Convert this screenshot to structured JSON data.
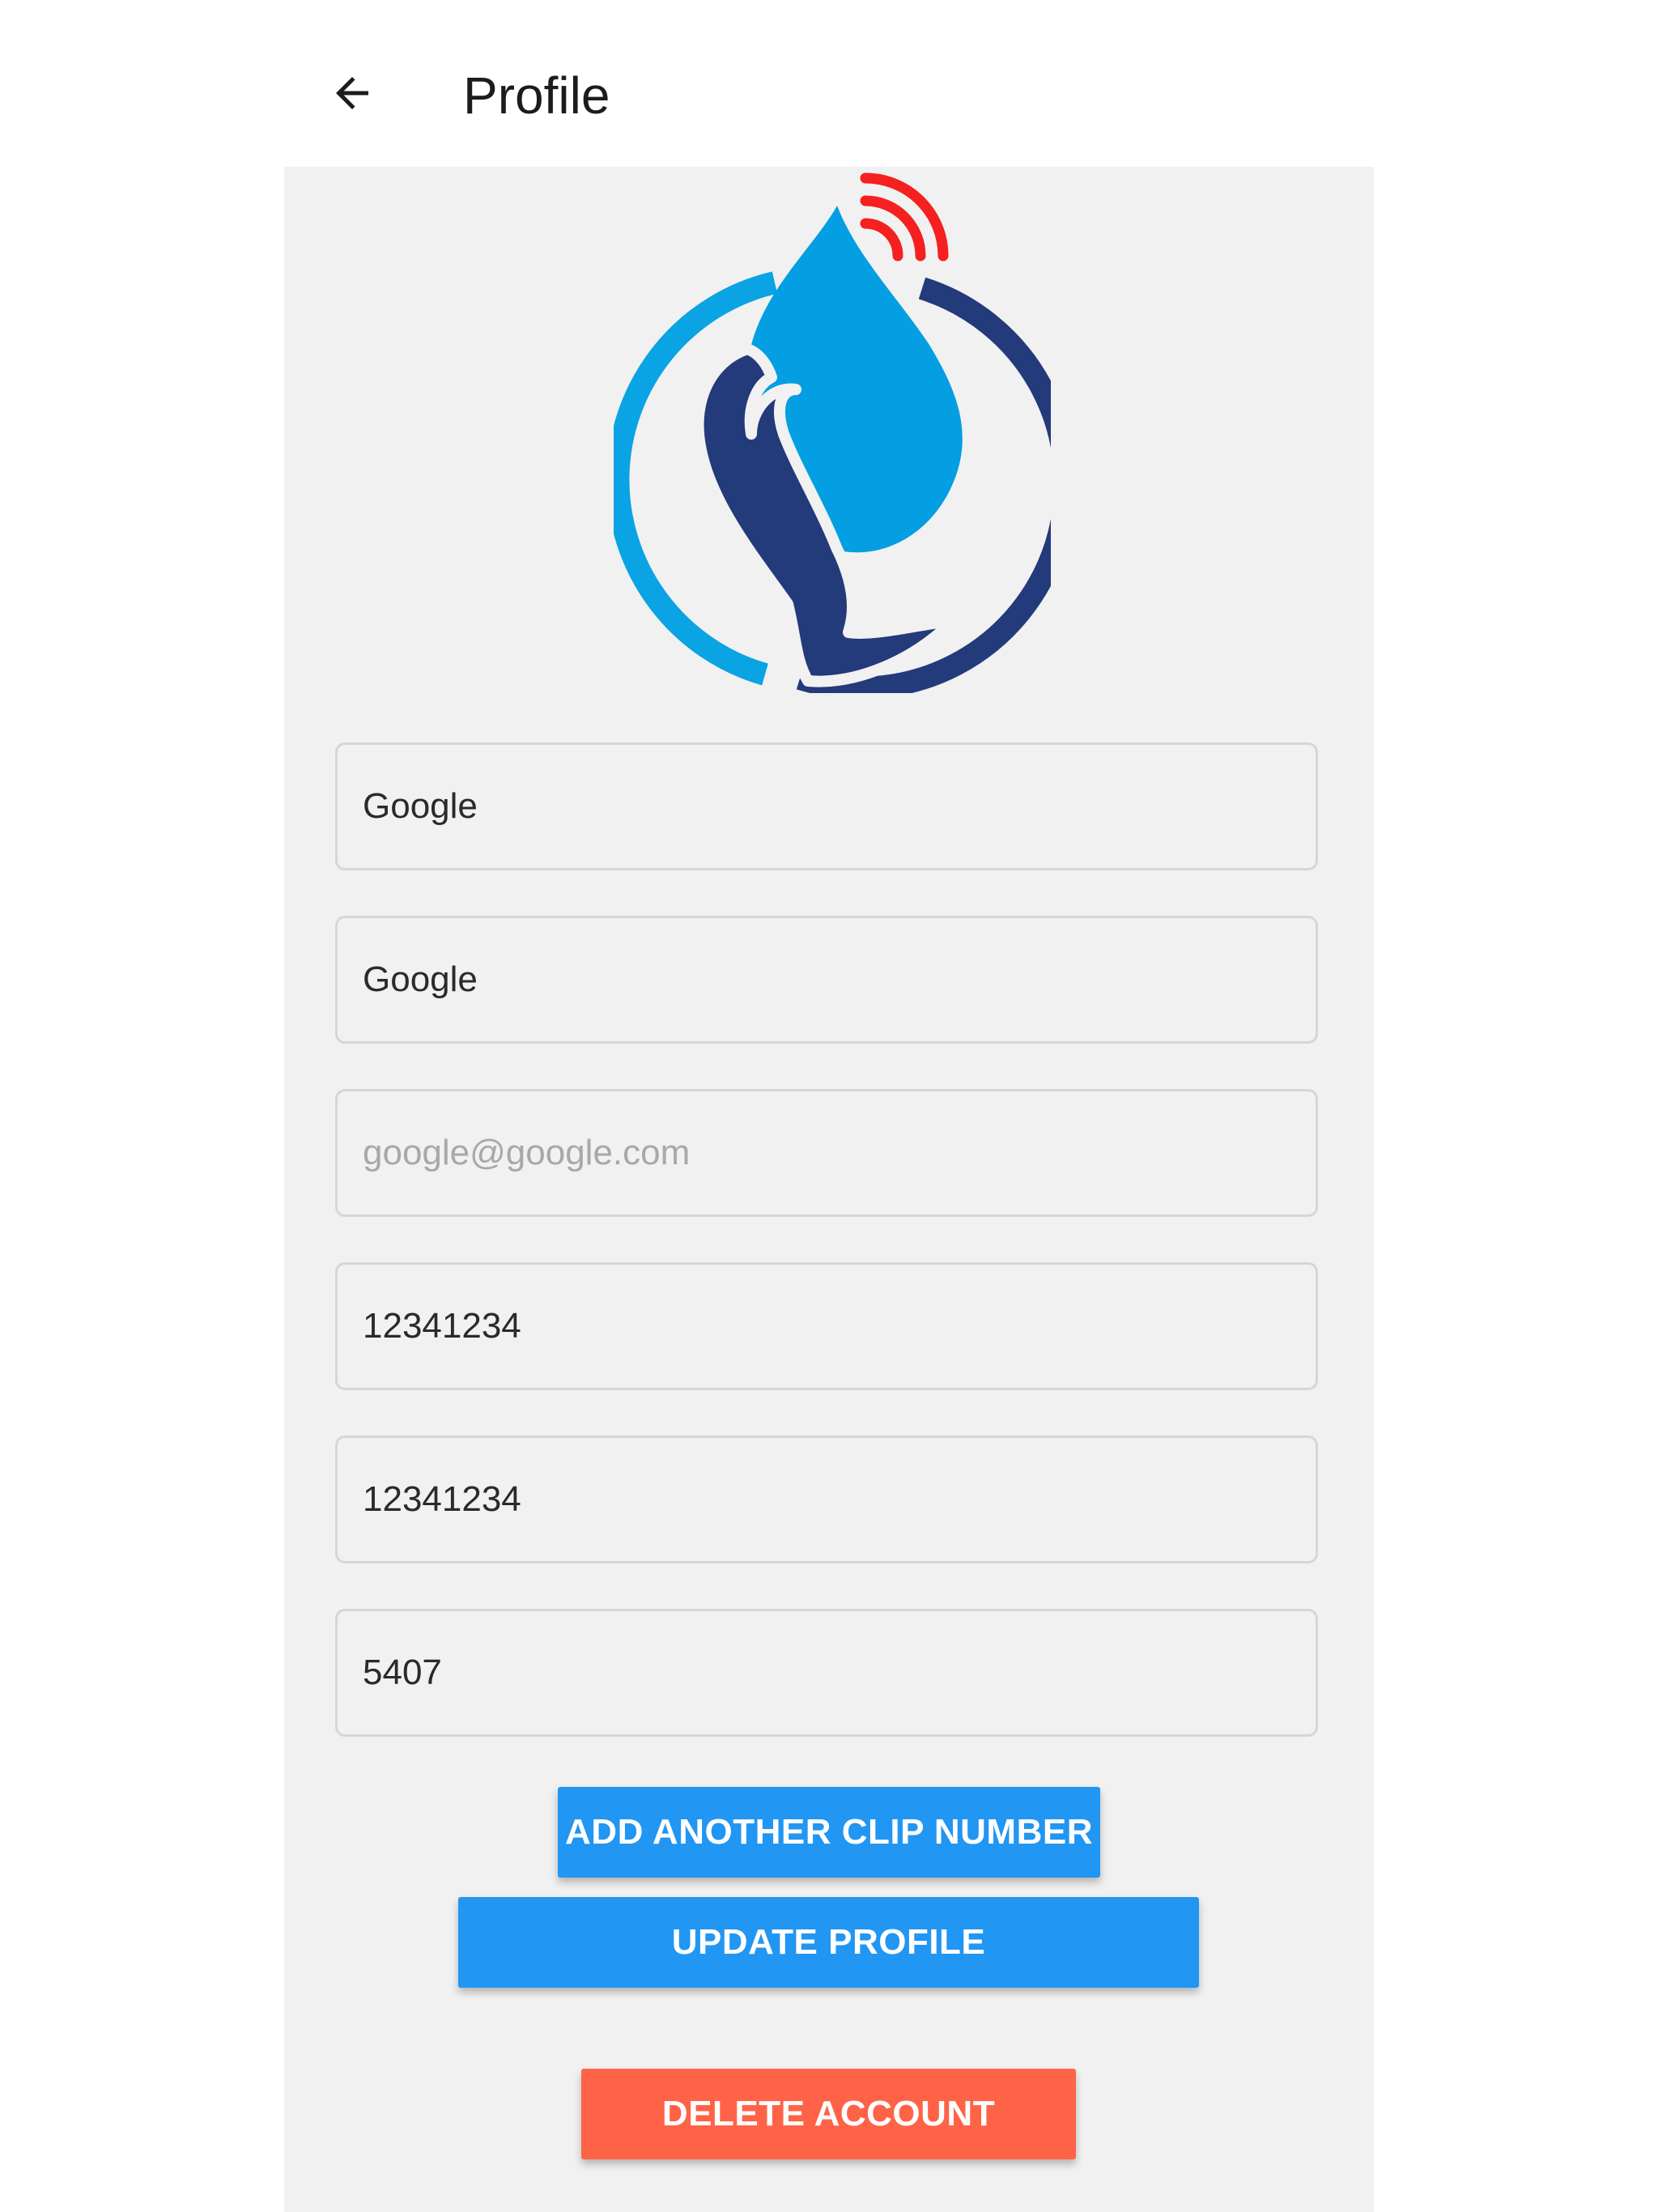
{
  "header": {
    "title": "Profile",
    "back_icon": "arrow-left-icon"
  },
  "logo": {
    "icon": "water-drop-hand-logo",
    "colors": {
      "drop": "#039fe2",
      "hand": "#233a7b",
      "ring_light": "#0aa3e4",
      "ring_dark": "#233a7b",
      "signal": "#f52020"
    }
  },
  "form": {
    "fields": [
      {
        "name": "first-name",
        "value": "Google",
        "placeholder": ""
      },
      {
        "name": "last-name",
        "value": "Google",
        "placeholder": ""
      },
      {
        "name": "email",
        "value": "",
        "placeholder": "google@google.com"
      },
      {
        "name": "phone",
        "value": "12341234",
        "placeholder": ""
      },
      {
        "name": "mobile",
        "value": "12341234",
        "placeholder": ""
      },
      {
        "name": "clip-number",
        "value": "5407",
        "placeholder": ""
      }
    ]
  },
  "buttons": {
    "add_clip": "ADD ANOTHER CLIP NUMBER",
    "update": "UPDATE PROFILE",
    "delete": "DELETE ACCOUNT"
  },
  "colors": {
    "primary": "#2196f3",
    "danger": "#ff6347",
    "background": "#f1f1f1"
  }
}
